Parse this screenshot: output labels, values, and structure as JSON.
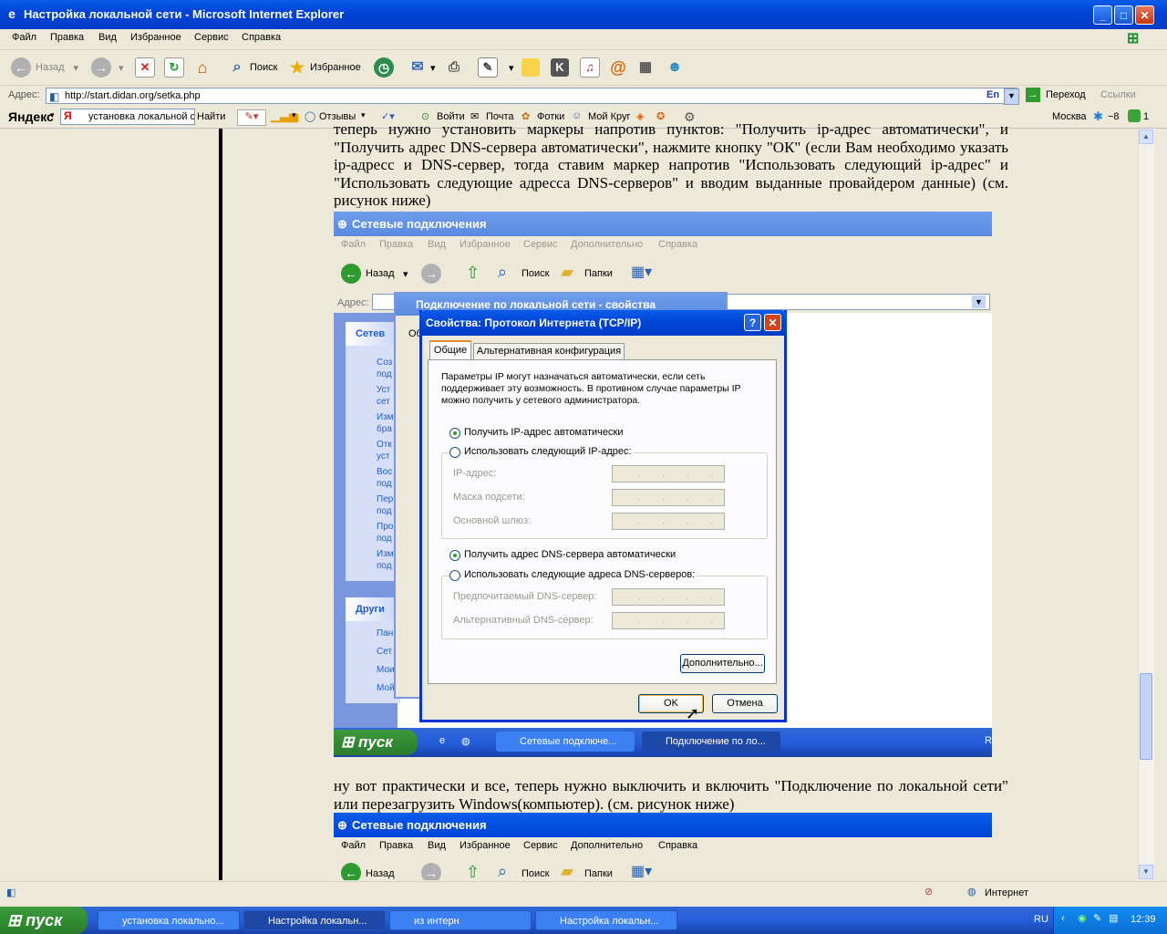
{
  "window": {
    "title": "Настройка локальной сети - Microsoft Internet Explorer",
    "min": "_",
    "max": "□",
    "close": "✕"
  },
  "menu": [
    "Файл",
    "Правка",
    "Вид",
    "Избранное",
    "Сервис",
    "Справка"
  ],
  "toolbar": {
    "back": "Назад",
    "search": "Поиск",
    "favorites": "Избранное"
  },
  "address": {
    "label": "Адрес:",
    "url": "http://start.didan.org/setka.php",
    "lang": "En",
    "go": "Переход",
    "links": "Ссылки"
  },
  "yandex": {
    "logo": "Яндекс",
    "query": "установка локальной с",
    "find": "Найти",
    "reviews": "Отзывы",
    "login": "Войти",
    "mail": "Почта",
    "photos": "Фотки",
    "mycircle": "Мой Круг",
    "city": "Москва",
    "temp": "−8",
    "count": "1"
  },
  "article": {
    "para1": "теперь нужно установить маркеры напротив пунктов: \"Получить ip-адрес автоматически\", и \"Получить адрес DNS-сервера автоматически\", нажмите кнопку \"ОК\" (если Вам необходимо указать ip-адресс и DNS-сервер, тогда ставим маркер напротив \"Использовать следующий ip-адрес\" и \"Использовать следующие адресса DNS-серверов\" и вводим выданные провайдером данные) (см. рисунок ниже)",
    "para2": "ну вот практически и все, теперь нужно выключить и включить \"Подключение по локальной сети\" или перезагрузить Windows(компьютер). (см. рисунок ниже)"
  },
  "shot1": {
    "title": "Сетевые подключения",
    "menu": [
      "Файл",
      "Правка",
      "Вид",
      "Избранное",
      "Сервис",
      "Дополнительно",
      "Справка"
    ],
    "back": "Назад",
    "search": "Поиск",
    "folders": "Папки",
    "addr": "Адрес:",
    "side_title": "Сетев",
    "side_items": [
      "Соз под",
      "Уст сет",
      "Изм бра",
      "Отк уст",
      "Вос под",
      "Пер под",
      "Про под",
      "Изм под"
    ],
    "other_title": "Други",
    "other_items": [
      "Пан",
      "Сет",
      "Мои",
      "Мой"
    ],
    "props_title": "Подключение по локальной сети - свойства",
    "props_tab": "Об",
    "start": "пуск",
    "task1": "Сетевые подключе...",
    "task2": "Подключение по ло...",
    "tray": "R"
  },
  "dialog": {
    "title": "Свойства: Протокол Интернета (TCP/IP)",
    "tab_general": "Общие",
    "tab_alt": "Альтернативная конфигурация",
    "desc": "Параметры IP могут назначаться автоматически, если сеть поддерживает эту возможность. В противном случае параметры IP можно получить у сетевого администратора.",
    "r_auto_ip": "Получить IP-адрес автоматически",
    "r_manual_ip": "Использовать следующий IP-адрес:",
    "ip": "IP-адрес:",
    "mask": "Маска подсети:",
    "gateway": "Основной шлюз:",
    "r_auto_dns": "Получить адрес DNS-сервера автоматически",
    "r_manual_dns": "Использовать следующие адреса DNS-серверов:",
    "dns1": "Предпочитаемый DNS-сервер:",
    "dns2": "Альтернативный DNS-сервер:",
    "advanced": "Дополнительно...",
    "ok": "OK",
    "cancel": "Отмена",
    "ip_dots": "...."
  },
  "shot2": {
    "title": "Сетевые подключения",
    "menu": [
      "Файл",
      "Правка",
      "Вид",
      "Избранное",
      "Сервис",
      "Дополнительно",
      "Справка"
    ],
    "back": "Назад",
    "search": "Поиск",
    "folders": "Папки"
  },
  "status": {
    "zone": "Интернет"
  },
  "taskbar": {
    "start": "пуск",
    "tasks": [
      "установка локально...",
      "Настройка локальн...",
      "из интерн",
      "Настройка локальн..."
    ],
    "lang": "RU",
    "time": "12:39"
  },
  "colors": {
    "titlebar": "#0A5BE8",
    "taskbar": "#245EDC",
    "start": "#2E8B2E"
  }
}
